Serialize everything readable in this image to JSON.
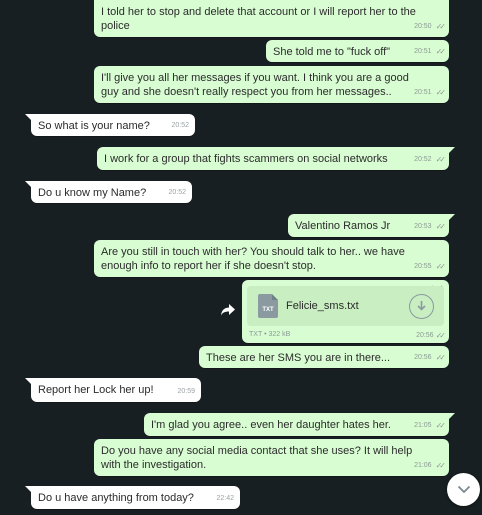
{
  "messages": [
    {
      "dir": "out",
      "text": "I told her to stop and delete that account or I will report her to the police",
      "time": "20:50",
      "read": true
    },
    {
      "dir": "out",
      "text": "She told me to \"fuck off\"",
      "time": "20:51",
      "read": true
    },
    {
      "dir": "out",
      "text": "I'll give you all her messages if you want. I think you are a good guy and she doesn't really respect you from her messages..",
      "time": "20:51",
      "read": true
    },
    {
      "dir": "in",
      "text": "So what is your name?",
      "time": "20:52"
    },
    {
      "dir": "out",
      "text": "I work for a group that fights scammers on social networks",
      "time": "20:52",
      "read": true
    },
    {
      "dir": "in",
      "text": "Do u know my Name?",
      "time": "20:52"
    },
    {
      "dir": "out",
      "text": "Valentino Ramos Jr",
      "time": "20:53",
      "read": true
    },
    {
      "dir": "out",
      "text": "Are you still in touch with her? You should talk to her.. we have enough info to report her if she doesn't stop.",
      "time": "20:55",
      "read": true
    },
    {
      "dir": "out",
      "text": "These are her SMS you are in there...",
      "time": "20:56",
      "read": true
    },
    {
      "dir": "in",
      "text": "Report her Lock her up!",
      "time": "20:59"
    },
    {
      "dir": "out",
      "text": "I'm glad you agree.. even her daughter hates her.",
      "time": "21:05",
      "read": true
    },
    {
      "dir": "out",
      "text": "Do you have any social media contact that she uses? It will help with the investigation.",
      "time": "21:06",
      "read": true
    },
    {
      "dir": "in",
      "text": "Do u have anything from today?",
      "time": "22:42"
    }
  ],
  "attachment": {
    "file_name": "Felicie_sms.txt",
    "file_type": "TXT",
    "file_type_badge": "TXT",
    "file_size": "322 kB",
    "separator": "•",
    "time": "20:56",
    "icon": "txt-file-icon"
  },
  "icons": {
    "read_ticks": "double-check-icon",
    "forward": "forward-arrow-icon",
    "download": "download-icon",
    "menu": "chevron-down-icon",
    "scroll_down": "chevron-down-icon"
  },
  "colors": {
    "background": "#181f22",
    "outgoing_bubble": "#d9fdd3",
    "incoming_bubble": "#ffffff",
    "meta_text": "#8a9a93"
  }
}
